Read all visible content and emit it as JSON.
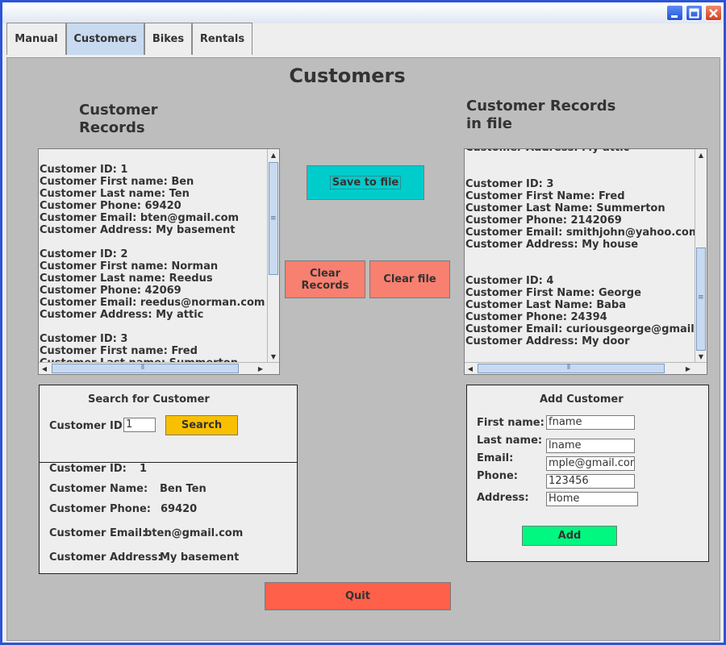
{
  "tabs": [
    "Manual",
    "Customers",
    "Bikes",
    "Rentals"
  ],
  "panel_title": "Customers",
  "left_records": {
    "heading": "Customer\nRecords",
    "text": "\nCustomer ID: 1\nCustomer First name: Ben\nCustomer Last name: Ten\nCustomer Phone: 69420\nCustomer Email: bten@gmail.com\nCustomer Address: My basement\n\nCustomer ID: 2\nCustomer First name: Norman\nCustomer Last name: Reedus\nCustomer Phone: 42069\nCustomer Email: reedus@norman.com\nCustomer Address: My attic\n\nCustomer ID: 3\nCustomer First name: Fred\nCustomer Last name: Summerton"
  },
  "right_records": {
    "heading": "Customer Records\nin file",
    "text": "Customer Address: My attic\n\n\nCustomer ID: 3\nCustomer First Name: Fred\nCustomer Last Name: Summerton\nCustomer Phone: 2142069\nCustomer Email: smithjohn@yahoo.com\nCustomer Address: My house\n\n\nCustomer ID: 4\nCustomer First Name: George\nCustomer Last Name: Baba\nCustomer Phone: 24394\nCustomer Email: curiousgeorge@gmail.com\nCustomer Address: My door"
  },
  "buttons": {
    "save_to_file": "Save to file",
    "clear_records": "Clear\nRecords",
    "clear_file": "Clear file",
    "quit": "Quit",
    "search": "Search",
    "add": "Add"
  },
  "search": {
    "title": "Search for Customer",
    "id_label": "Customer ID:",
    "id_value": "1"
  },
  "result": {
    "id_label": "Customer ID:",
    "id_value": "1",
    "name_label": "Customer Name:",
    "name_value": "Ben Ten",
    "phone_label": "Customer Phone:",
    "phone_value": "69420",
    "email_label": "Customer Email:",
    "email_value": "bten@gmail.com",
    "address_label": "Customer Address:",
    "address_value": "My basement"
  },
  "add_customer": {
    "title": "Add Customer",
    "first_label": "First name:",
    "first_value": "fname",
    "last_label": "Last name:",
    "last_value": "lname",
    "email_label": "Email:",
    "email_value": "mple@gmail.com",
    "phone_label": "Phone:",
    "phone_value": "123456",
    "address_label": "Address:",
    "address_value": "Home"
  },
  "colors": {
    "save_button": "#00cccc",
    "clear_button": "#f88070",
    "search_button": "#f8c000",
    "add_button": "#00f880",
    "quit_button": "#ff604a",
    "panel_bg": "#bdbdbd"
  },
  "icons": {
    "minimize": "minimize-icon",
    "maximize": "maximize-icon",
    "close": "close-icon"
  }
}
